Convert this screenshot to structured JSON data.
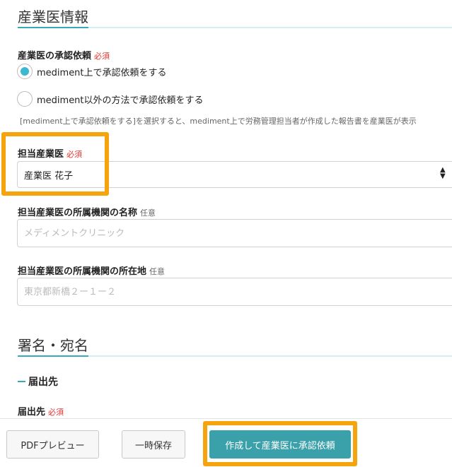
{
  "sections": {
    "occupational_physician": {
      "title": "産業医情報"
    },
    "signature": {
      "title": "署名・宛名"
    }
  },
  "approval_request": {
    "label": "産業医の承認依頼",
    "required": "必須",
    "options": [
      {
        "label": "mediment上で承認依頼をする",
        "selected": true
      },
      {
        "label": "mediment以外の方法で承認依頼をする",
        "selected": false
      }
    ],
    "help": "[mediment上で承認依頼をする]を選択すると、mediment上で労務管理担当者が作成した報告書を産業医が表示"
  },
  "physician": {
    "label": "担当産業医",
    "required": "必須",
    "selected": "産業医 花子"
  },
  "institution_name": {
    "label": "担当産業医の所属機関の名称",
    "optional": "任意",
    "placeholder": "メディメントクリニック"
  },
  "institution_address": {
    "label": "担当産業医の所属機関の所在地",
    "optional": "任意",
    "placeholder": "東京都新橋２ー１ー２"
  },
  "destination": {
    "heading": "届出先",
    "label": "届出先",
    "required": "必須"
  },
  "footer": {
    "pdf_preview": "PDFプレビュー",
    "save_draft": "一時保存",
    "submit": "作成して産業医に承認依頼"
  },
  "colors": {
    "accent": "#3aa9b6",
    "primary_button": "#3aa0aa",
    "radio_selected": "#3cb8d0",
    "required": "#e0322e",
    "highlight": "#f6a40d"
  }
}
